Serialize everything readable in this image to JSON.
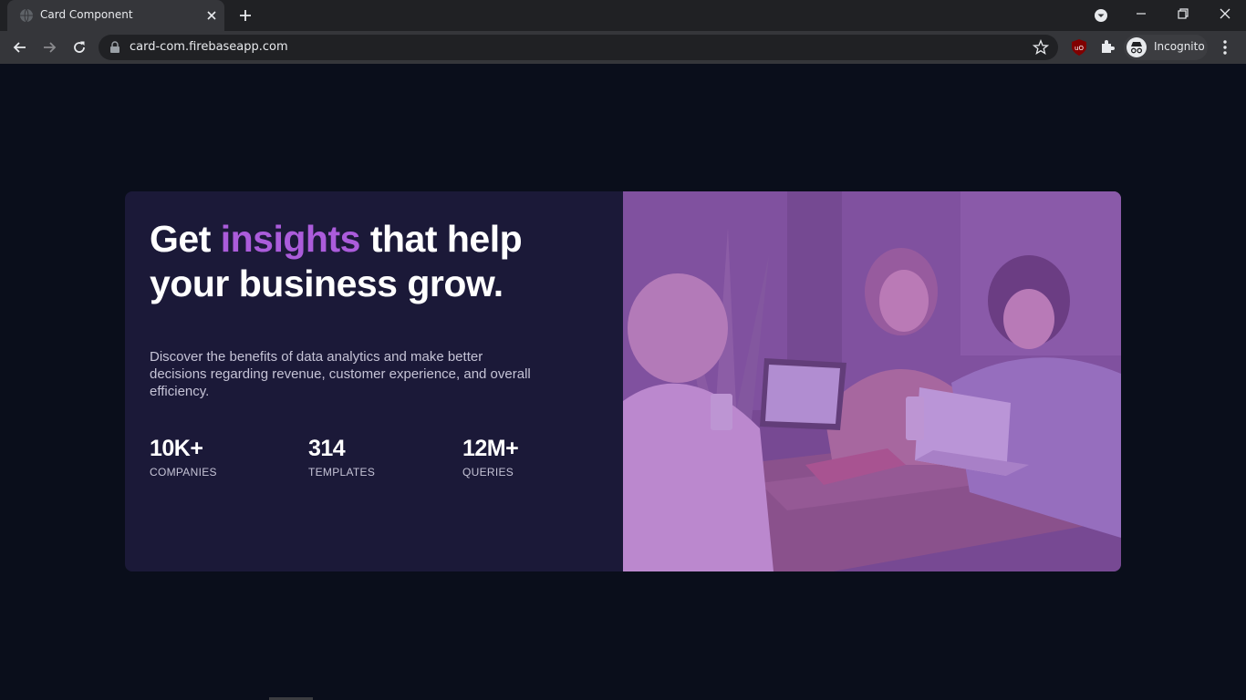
{
  "browser": {
    "tab": {
      "title": "Card Component",
      "favicon": "globe-icon"
    },
    "url": "card-com.firebaseapp.com",
    "profile_label": "Incognito",
    "icons": [
      "back-icon",
      "forward-icon",
      "reload-icon",
      "lock-icon",
      "star-icon",
      "ublock-icon",
      "puzzle-icon",
      "incognito-icon",
      "menu-icon"
    ]
  },
  "card": {
    "headline_start": "Get ",
    "headline_accent": "insights",
    "headline_end": " that help your business grow.",
    "description": "Discover the benefits of data analytics and make better decisions regarding revenue, customer experience, and overall efficiency.",
    "stats": [
      {
        "value": "10K+",
        "label": "COMPANIES"
      },
      {
        "value": "314",
        "label": "TEMPLATES"
      },
      {
        "value": "12M+",
        "label": "QUERIES"
      }
    ],
    "image": "photo of three people working at a table with laptops, purple overlay"
  },
  "colors": {
    "page_bg": "#0a0e1b",
    "card_bg": "#1b1938",
    "accent": "#ab5cdb",
    "image_overlay": "#aa5cdb"
  }
}
